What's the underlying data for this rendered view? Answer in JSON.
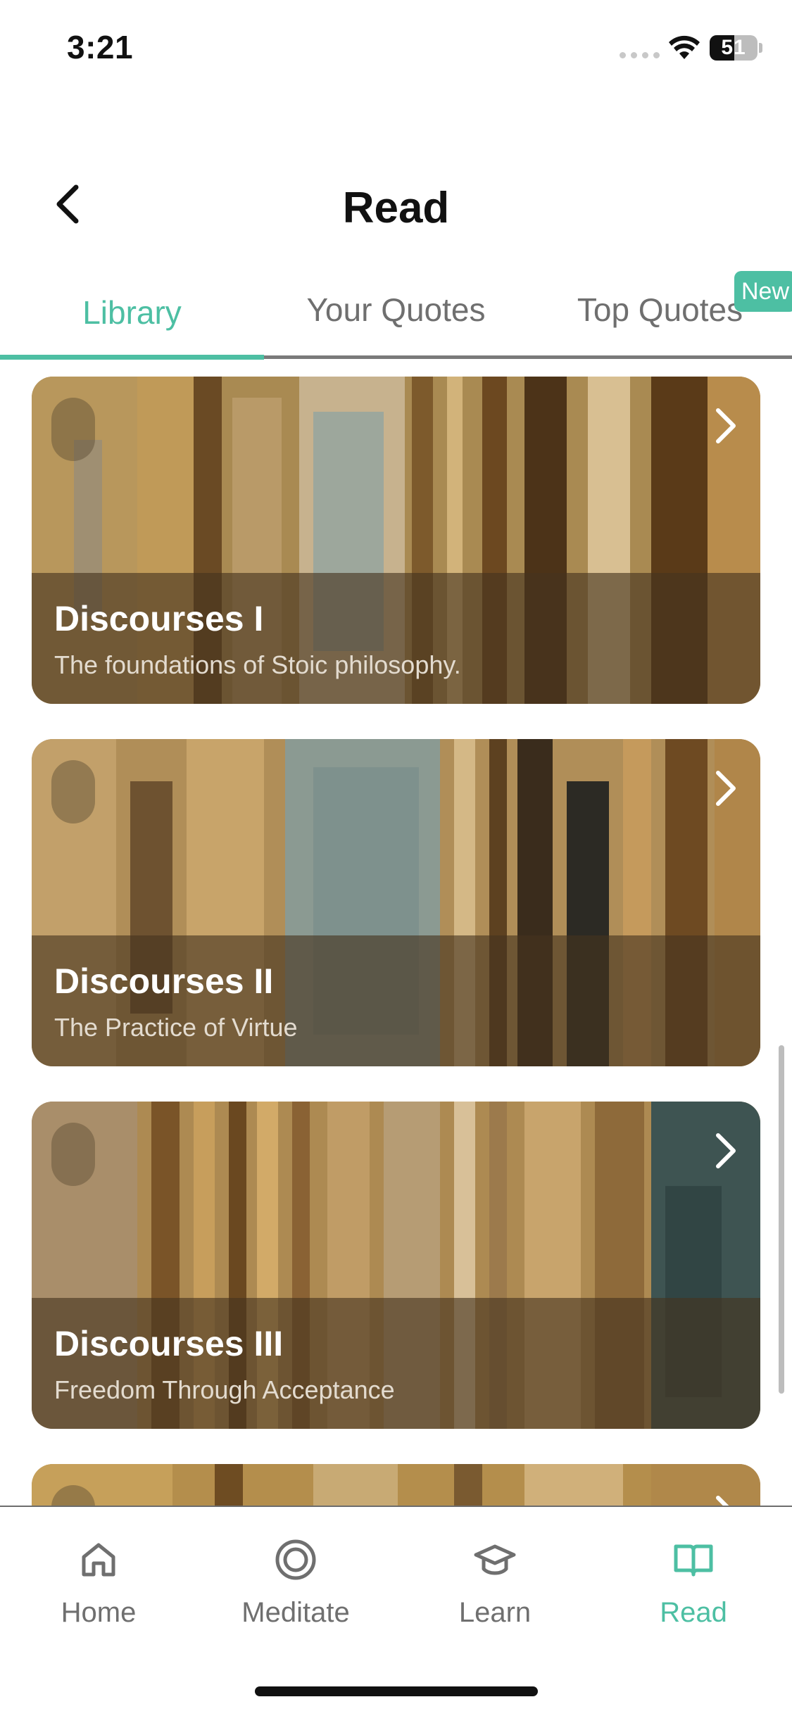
{
  "status_bar": {
    "time": "3:21",
    "battery_percent": "51",
    "battery_level": 0.51
  },
  "header": {
    "title": "Read",
    "back_icon": "chevron-left-icon"
  },
  "tabs": [
    {
      "label": "Library",
      "active": true
    },
    {
      "label": "Your Quotes",
      "active": false
    },
    {
      "label": "Top Quotes",
      "active": false,
      "badge": "New"
    }
  ],
  "library": {
    "cards": [
      {
        "title": "Discourses I",
        "subtitle": "The foundations of Stoic philosophy."
      },
      {
        "title": "Discourses II",
        "subtitle": "The Practice of Virtue"
      },
      {
        "title": "Discourses III",
        "subtitle": " Freedom Through Acceptance"
      }
    ]
  },
  "bottom_nav": [
    {
      "label": "Home",
      "icon": "home-icon",
      "active": false
    },
    {
      "label": "Meditate",
      "icon": "meditate-icon",
      "active": false
    },
    {
      "label": "Learn",
      "icon": "graduation-cap-icon",
      "active": false
    },
    {
      "label": "Read",
      "icon": "book-open-icon",
      "active": true
    }
  ],
  "colors": {
    "accent": "#4dbfa3",
    "inactive_text": "#6f6f6f",
    "card_overlay": "#46341e"
  }
}
